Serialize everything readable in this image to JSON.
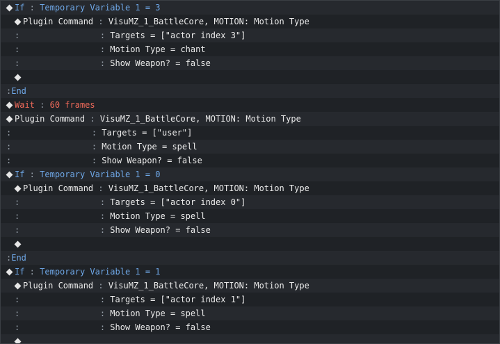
{
  "colors": {
    "background": "#1f2226",
    "row_alt": "#26292e",
    "keyword_blue": "#6fa8e8",
    "keyword_red": "#f06a5a",
    "text": "#eaeaea"
  },
  "rows": [
    {
      "indent": 0,
      "marker": "diamond",
      "keyword": "If",
      "sep": " : ",
      "text": "Temporary Variable 1 = 3",
      "color": "blue"
    },
    {
      "indent": 1,
      "marker": "diamond",
      "keyword": "Plugin Command",
      "sep": " : ",
      "text": "VisuMZ_1_BattleCore, MOTION: Motion Type",
      "color": "white"
    },
    {
      "indent": 1,
      "marker": "colon",
      "pad": "               ",
      "sep": " : ",
      "text": "Targets = [\"actor index 3\"]",
      "color": "white"
    },
    {
      "indent": 1,
      "marker": "colon",
      "pad": "               ",
      "sep": " : ",
      "text": "Motion Type = chant",
      "color": "white"
    },
    {
      "indent": 1,
      "marker": "colon",
      "pad": "               ",
      "sep": " : ",
      "text": "Show Weapon? = false",
      "color": "white"
    },
    {
      "indent": 1,
      "marker": "diamond",
      "keyword": "",
      "sep": "",
      "text": "",
      "color": "white"
    },
    {
      "indent": 0,
      "marker": "colon-only",
      "keyword": "End",
      "sep": "",
      "text": "",
      "color": "blue"
    },
    {
      "indent": 0,
      "marker": "diamond",
      "keyword": "Wait",
      "sep": " : ",
      "text": "60 frames",
      "color": "red"
    },
    {
      "indent": 0,
      "marker": "diamond",
      "keyword": "Plugin Command",
      "sep": " : ",
      "text": "VisuMZ_1_BattleCore, MOTION: Motion Type",
      "color": "white"
    },
    {
      "indent": 0,
      "marker": "colon",
      "pad": "               ",
      "sep": " : ",
      "text": "Targets = [\"user\"]",
      "color": "white"
    },
    {
      "indent": 0,
      "marker": "colon",
      "pad": "               ",
      "sep": " : ",
      "text": "Motion Type = spell",
      "color": "white"
    },
    {
      "indent": 0,
      "marker": "colon",
      "pad": "               ",
      "sep": " : ",
      "text": "Show Weapon? = false",
      "color": "white"
    },
    {
      "indent": 0,
      "marker": "diamond",
      "keyword": "If",
      "sep": " : ",
      "text": "Temporary Variable 1 = 0",
      "color": "blue"
    },
    {
      "indent": 1,
      "marker": "diamond",
      "keyword": "Plugin Command",
      "sep": " : ",
      "text": "VisuMZ_1_BattleCore, MOTION: Motion Type",
      "color": "white"
    },
    {
      "indent": 1,
      "marker": "colon",
      "pad": "               ",
      "sep": " : ",
      "text": "Targets = [\"actor index 0\"]",
      "color": "white"
    },
    {
      "indent": 1,
      "marker": "colon",
      "pad": "               ",
      "sep": " : ",
      "text": "Motion Type = spell",
      "color": "white"
    },
    {
      "indent": 1,
      "marker": "colon",
      "pad": "               ",
      "sep": " : ",
      "text": "Show Weapon? = false",
      "color": "white"
    },
    {
      "indent": 1,
      "marker": "diamond",
      "keyword": "",
      "sep": "",
      "text": "",
      "color": "white"
    },
    {
      "indent": 0,
      "marker": "colon-only",
      "keyword": "End",
      "sep": "",
      "text": "",
      "color": "blue"
    },
    {
      "indent": 0,
      "marker": "diamond",
      "keyword": "If",
      "sep": " : ",
      "text": "Temporary Variable 1 = 1",
      "color": "blue"
    },
    {
      "indent": 1,
      "marker": "diamond",
      "keyword": "Plugin Command",
      "sep": " : ",
      "text": "VisuMZ_1_BattleCore, MOTION: Motion Type",
      "color": "white"
    },
    {
      "indent": 1,
      "marker": "colon",
      "pad": "               ",
      "sep": " : ",
      "text": "Targets = [\"actor index 1\"]",
      "color": "white"
    },
    {
      "indent": 1,
      "marker": "colon",
      "pad": "               ",
      "sep": " : ",
      "text": "Motion Type = spell",
      "color": "white"
    },
    {
      "indent": 1,
      "marker": "colon",
      "pad": "               ",
      "sep": " : ",
      "text": "Show Weapon? = false",
      "color": "white"
    },
    {
      "indent": 1,
      "marker": "diamond",
      "keyword": "",
      "sep": "",
      "text": "",
      "color": "white"
    }
  ]
}
